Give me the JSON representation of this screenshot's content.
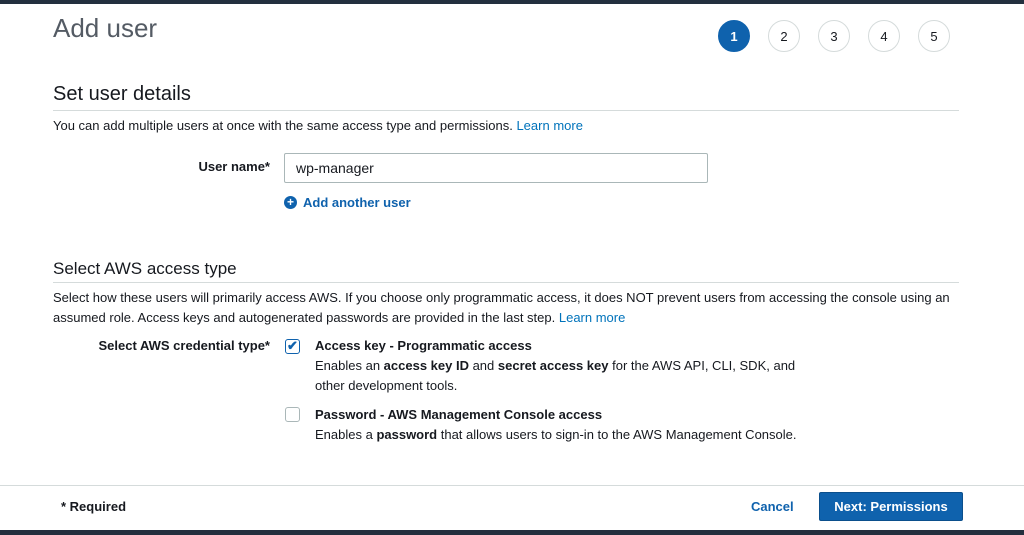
{
  "page": {
    "title": "Add user"
  },
  "steps": [
    "1",
    "2",
    "3",
    "4",
    "5"
  ],
  "user_details": {
    "title": "Set user details",
    "description": "You can add multiple users at once with the same access type and permissions.",
    "learn_more": "Learn more",
    "user_name_label": "User name*",
    "user_name_value": "wp-manager",
    "add_another_label": "Add another user"
  },
  "access_type": {
    "title": "Select AWS access type",
    "description": "Select how these users will primarily access AWS. If you choose only programmatic access, it does NOT prevent users from accessing the console using an assumed role. Access keys and autogenerated passwords are provided in the last step.",
    "learn_more": "Learn more",
    "credential_label": "Select AWS credential type*",
    "options": [
      {
        "title": "Access key - Programmatic access",
        "checked": true,
        "desc_1": "Enables an ",
        "bold_1": "access key ID",
        "desc_2": " and ",
        "bold_2": "secret access key",
        "desc_3": " for the AWS API, CLI, SDK, and other development tools."
      },
      {
        "title": "Password - AWS Management Console access",
        "checked": false,
        "desc_1": "Enables a ",
        "bold_1": "password",
        "desc_2": " that allows users to sign-in to the AWS Management Console."
      }
    ]
  },
  "footer": {
    "required": "* Required",
    "cancel": "Cancel",
    "next": "Next: Permissions"
  },
  "colors": {
    "primary": "#0f62ad",
    "link": "#0073bb",
    "border": "#d5dbdb",
    "header": "#232f3e"
  }
}
